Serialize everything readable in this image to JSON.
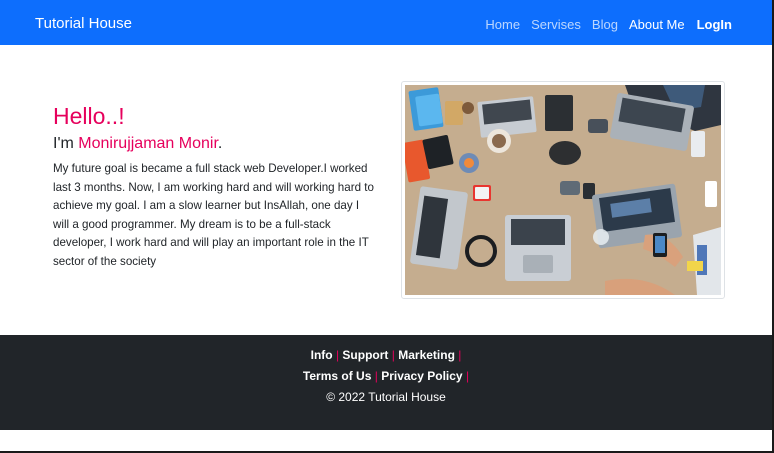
{
  "navbar": {
    "brand": "Tutorial House",
    "links": [
      {
        "label": "Home"
      },
      {
        "label": "Servises"
      },
      {
        "label": "Blog"
      },
      {
        "label": "About Me"
      },
      {
        "label": "LogIn"
      }
    ]
  },
  "hero": {
    "greeting": "Hello..!",
    "intro_prefix": "I'm ",
    "name": "Monirujjaman Monir",
    "intro_suffix": ".",
    "about": "My future goal is became a full stack web Developer.I worked last 3 months. Now, I am working hard and will working hard to achieve my goal. I am a slow learner but InsAllah, one day I will a good programmer. My dream is to be a full-stack developer, I work hard and will play an important role in the IT sector of the society"
  },
  "footer": {
    "row1": [
      "Info",
      "Support",
      "Marketing"
    ],
    "row2": [
      "Terms of Us",
      "Privacy Policy"
    ],
    "separator": "|",
    "copyright": "© 2022 Tutorial House"
  },
  "colors": {
    "nav_bg": "#0d6efd",
    "accent": "#e6005c",
    "footer_bg": "#212529"
  }
}
